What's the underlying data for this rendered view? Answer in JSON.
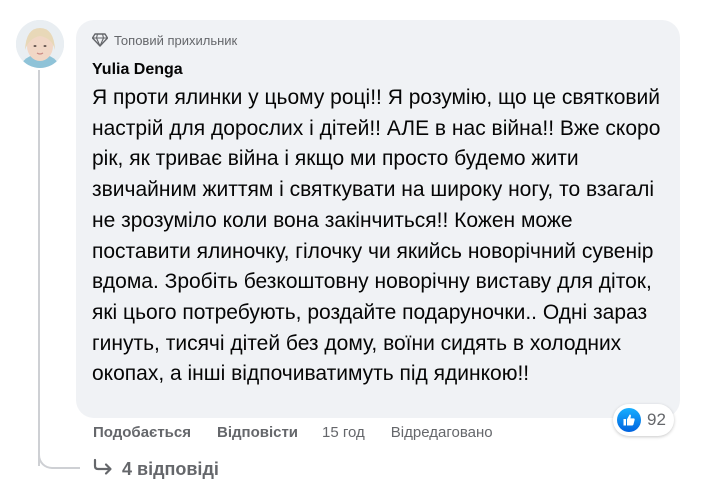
{
  "comment": {
    "badge": {
      "icon": "diamond-icon",
      "text": "Топовий прихильник"
    },
    "author": "Yulia Denga",
    "text": "Я проти ялинки у цьому році!! Я розумію, що це святковий настрій для дорослих і дітей!! АЛЕ в нас війна!! Вже скоро рік, як триває війна і якщо ми просто будемо жити звичайним життям і святкувати на широку ногу, то взагалі не зрозуміло коли вона закінчиться!! Кожен може поставити ялиночку, гілочку чи якийсь новорічний сувенір вдома. Зробіть безкоштовну новорічну виставу для діток, які цього потребують, роздайте подаруночки.. Одні зараз гинуть, тисячі дітей без дому, воїни сидять в холодних окопах, а інші відпочиватимуть під ядинкою!!",
    "reactions": {
      "icon": "like-icon",
      "count": "92"
    },
    "actions": {
      "like": "Подобається",
      "reply": "Відповісти",
      "time": "15 год",
      "edited": "Відредаговано"
    },
    "replies": {
      "icon": "reply-arrow-icon",
      "label": "4 відповіді"
    }
  }
}
